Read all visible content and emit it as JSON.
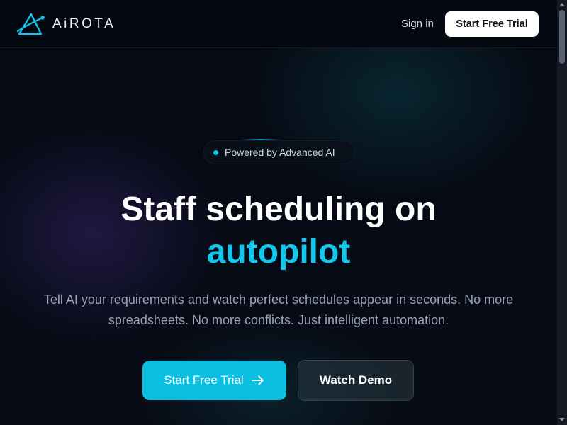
{
  "brand": {
    "name": "AiROTA",
    "logo_icon": "triangle-orbit-icon",
    "accent_color": "#12c6ec"
  },
  "nav": {
    "signin_label": "Sign in",
    "cta_label": "Start Free Trial"
  },
  "hero": {
    "badge_text": "Powered by Advanced AI",
    "headline_line1": "Staff scheduling on",
    "headline_accent": "autopilot",
    "subtext": "Tell AI your requirements and watch perfect schedules appear in seconds. No more spreadsheets. No more conflicts. Just intelligent automation.",
    "primary_cta_label": "Start Free Trial",
    "primary_cta_icon": "arrow-right-icon",
    "secondary_cta_label": "Watch Demo"
  },
  "colors": {
    "background": "#05080f",
    "primary_button": "#0bbfe2",
    "header_button": "#ffffff"
  }
}
